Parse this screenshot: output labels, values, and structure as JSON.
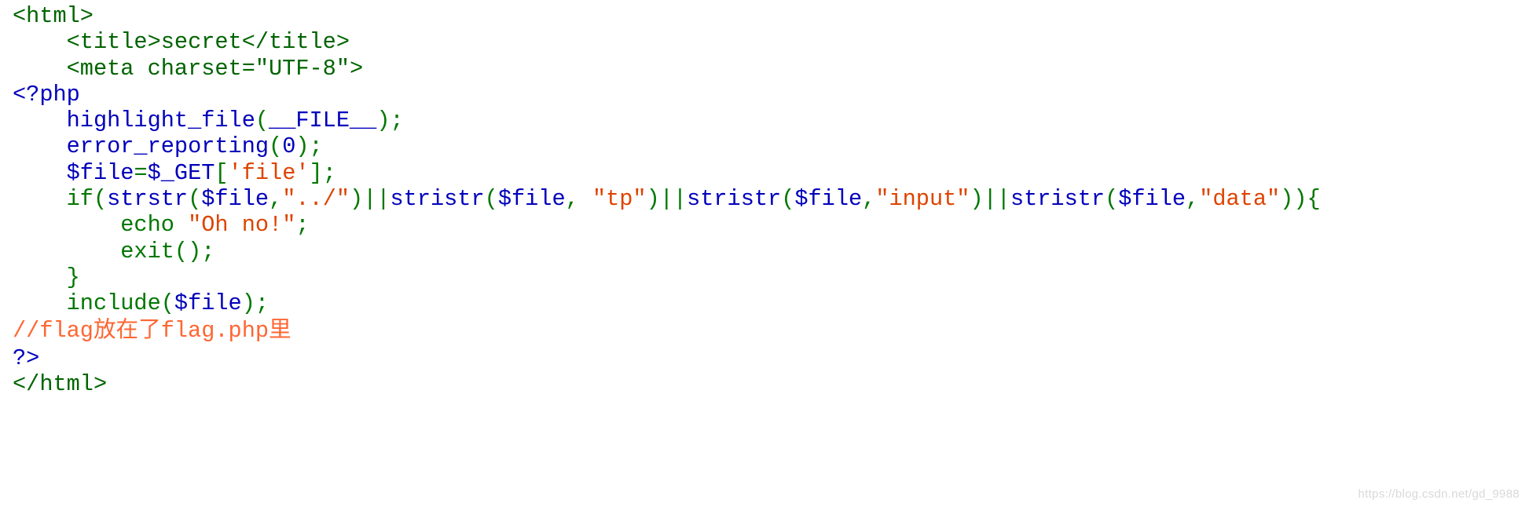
{
  "colors": {
    "html": "#006400",
    "keyword": "#0000BB",
    "string": "#DD4400",
    "default": "#007700",
    "comment": "#FF6633"
  },
  "code_lines": [
    [
      {
        "text": "<html>",
        "role": "html"
      }
    ],
    [
      {
        "text": "    <title>secret</title>",
        "role": "html"
      }
    ],
    [
      {
        "text": "    <meta charset=\"UTF-8\">",
        "role": "html"
      }
    ],
    [
      {
        "text": "<?php",
        "role": "keyword"
      }
    ],
    [
      {
        "text": "    highlight_file",
        "role": "keyword"
      },
      {
        "text": "(",
        "role": "default"
      },
      {
        "text": "__FILE__",
        "role": "keyword"
      },
      {
        "text": ");",
        "role": "default"
      }
    ],
    [
      {
        "text": "    error_reporting",
        "role": "keyword"
      },
      {
        "text": "(",
        "role": "default"
      },
      {
        "text": "0",
        "role": "keyword"
      },
      {
        "text": ");",
        "role": "default"
      }
    ],
    [
      {
        "text": "    $file",
        "role": "keyword"
      },
      {
        "text": "=",
        "role": "default"
      },
      {
        "text": "$_GET",
        "role": "keyword"
      },
      {
        "text": "[",
        "role": "default"
      },
      {
        "text": "'file'",
        "role": "string"
      },
      {
        "text": "];",
        "role": "default"
      }
    ],
    [
      {
        "text": "    if(",
        "role": "default"
      },
      {
        "text": "strstr",
        "role": "keyword"
      },
      {
        "text": "(",
        "role": "default"
      },
      {
        "text": "$file",
        "role": "keyword"
      },
      {
        "text": ",",
        "role": "default"
      },
      {
        "text": "\"../\"",
        "role": "string"
      },
      {
        "text": ")||",
        "role": "default"
      },
      {
        "text": "stristr",
        "role": "keyword"
      },
      {
        "text": "(",
        "role": "default"
      },
      {
        "text": "$file",
        "role": "keyword"
      },
      {
        "text": ", ",
        "role": "default"
      },
      {
        "text": "\"tp\"",
        "role": "string"
      },
      {
        "text": ")||",
        "role": "default"
      },
      {
        "text": "stristr",
        "role": "keyword"
      },
      {
        "text": "(",
        "role": "default"
      },
      {
        "text": "$file",
        "role": "keyword"
      },
      {
        "text": ",",
        "role": "default"
      },
      {
        "text": "\"input\"",
        "role": "string"
      },
      {
        "text": ")||",
        "role": "default"
      },
      {
        "text": "stristr",
        "role": "keyword"
      },
      {
        "text": "(",
        "role": "default"
      },
      {
        "text": "$file",
        "role": "keyword"
      },
      {
        "text": ",",
        "role": "default"
      },
      {
        "text": "\"data\"",
        "role": "string"
      },
      {
        "text": ")){",
        "role": "default"
      }
    ],
    [
      {
        "text": "        echo ",
        "role": "default"
      },
      {
        "text": "\"Oh no!\"",
        "role": "string"
      },
      {
        "text": ";",
        "role": "default"
      }
    ],
    [
      {
        "text": "        exit();",
        "role": "default"
      }
    ],
    [
      {
        "text": "    }",
        "role": "default"
      }
    ],
    [
      {
        "text": "    include(",
        "role": "default"
      },
      {
        "text": "$file",
        "role": "keyword"
      },
      {
        "text": ");",
        "role": "default"
      }
    ],
    [
      {
        "text": "//flag放在了flag.php里",
        "role": "comment"
      }
    ],
    [
      {
        "text": "?>",
        "role": "keyword"
      }
    ],
    [
      {
        "text": "</html>",
        "role": "html"
      }
    ]
  ],
  "watermark": "https://blog.csdn.net/gd_9988"
}
